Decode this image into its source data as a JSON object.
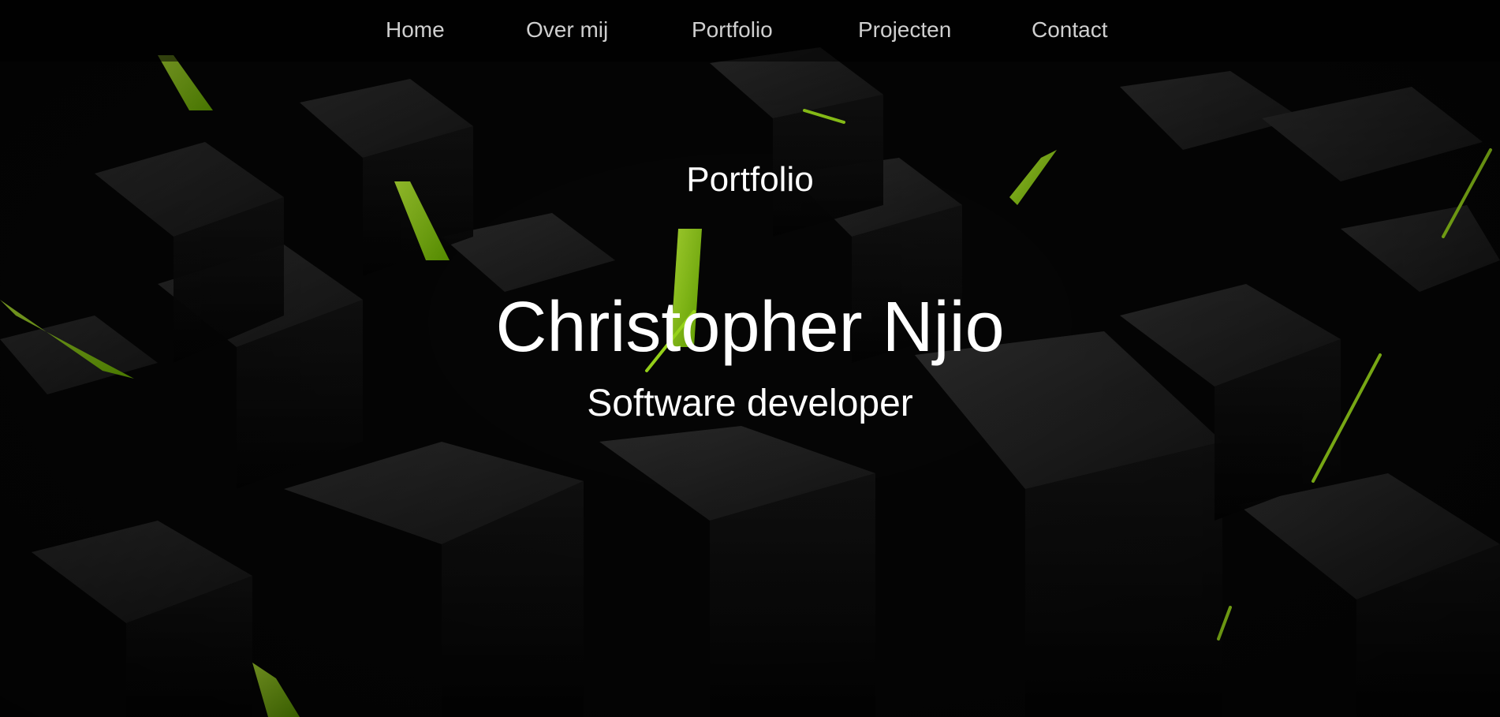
{
  "nav": {
    "items": [
      {
        "label": "Home"
      },
      {
        "label": "Over mij"
      },
      {
        "label": "Portfolio"
      },
      {
        "label": "Projecten"
      },
      {
        "label": "Contact"
      }
    ]
  },
  "hero": {
    "section_title": "Portfolio",
    "name": "Christopher Njio",
    "subtitle": "Software developer"
  },
  "colors": {
    "background": "#050505",
    "accent_glow": "#a6ff1a",
    "text": "#ffffff",
    "nav_text": "#cfcfcf"
  }
}
